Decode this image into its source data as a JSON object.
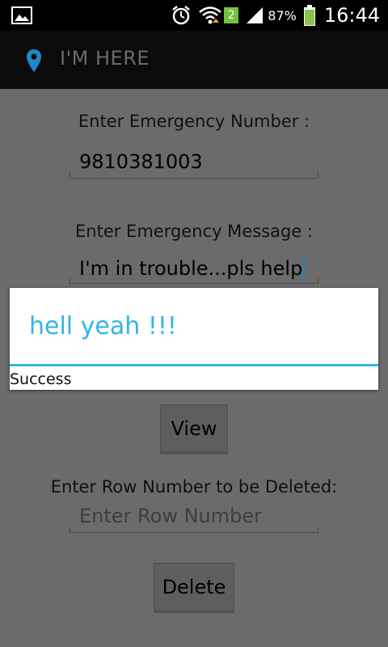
{
  "status_bar": {
    "icons": [
      "gallery-icon",
      "alarm-icon",
      "wifi-icon",
      "signal-icon",
      "battery-icon"
    ],
    "badge": "2",
    "battery_percent": "87%",
    "time": "16:44"
  },
  "action_bar": {
    "icon": "location-pin-icon",
    "title": "I'M HERE",
    "accent_color": "#1e88c8"
  },
  "form": {
    "number_label": "Enter Emergency Number :",
    "number_value": "9810381003",
    "message_label": "Enter Emergency Message :",
    "message_value": "I'm in trouble...pls help",
    "view_button": "View",
    "delete_row_label": "Enter Row Number to be Deleted:",
    "row_placeholder": "Enter Row Number",
    "delete_button": "Delete"
  },
  "dialog": {
    "title": "hell yeah !!!",
    "message": "Success",
    "accent_color": "#33b5e5"
  }
}
